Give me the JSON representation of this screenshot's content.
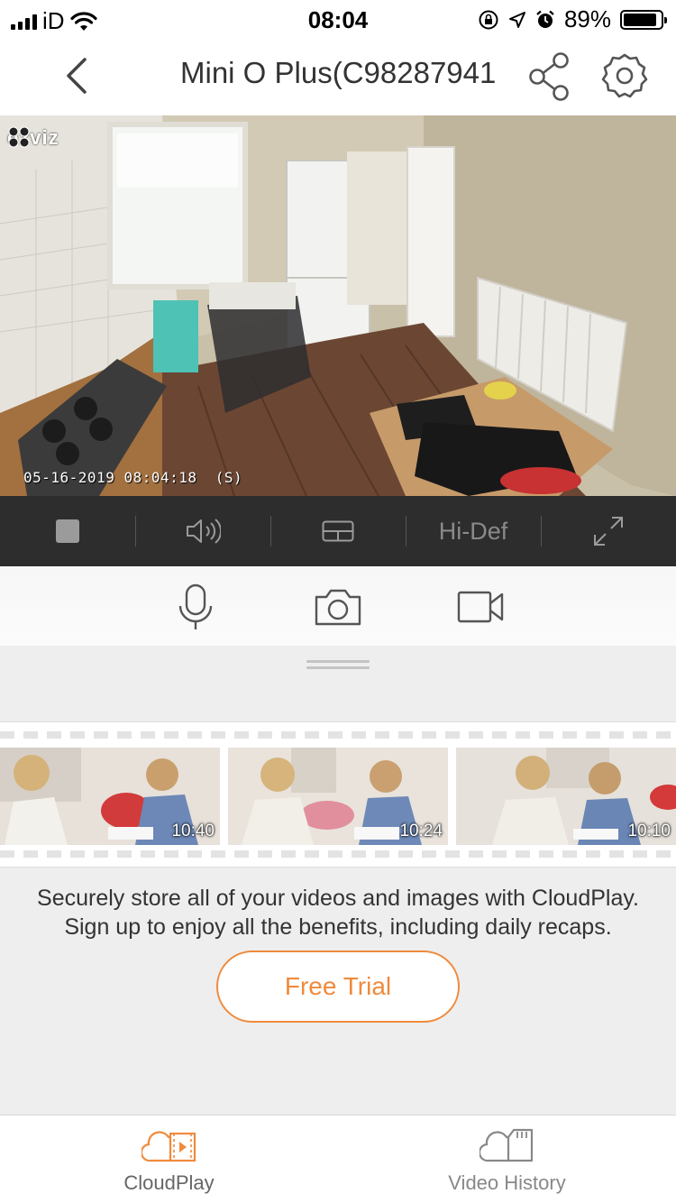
{
  "status_bar": {
    "carrier": "iD",
    "time": "08:04",
    "battery_percent": "89%",
    "battery_level": 0.89
  },
  "nav": {
    "title": "Mini O Plus(C98287941"
  },
  "feed": {
    "brand": "ezviz",
    "timestamp": "05-16-2019 08:04:18  (S)"
  },
  "controls": {
    "quality_label": "Hi-Def"
  },
  "thumbnails": [
    {
      "duration": "10:40"
    },
    {
      "duration": "10:24"
    },
    {
      "duration": "10:10"
    }
  ],
  "promo": {
    "line1": "Securely store all of your videos and images with CloudPlay.",
    "line2": "Sign up to enjoy all the benefits, including daily recaps.",
    "button_label": "Free Trial"
  },
  "tabs": [
    {
      "label": "CloudPlay",
      "active": true
    },
    {
      "label": "Video History",
      "active": false
    }
  ],
  "colors": {
    "accent": "#f08a3c",
    "control_bar": "#2d2d2d"
  }
}
